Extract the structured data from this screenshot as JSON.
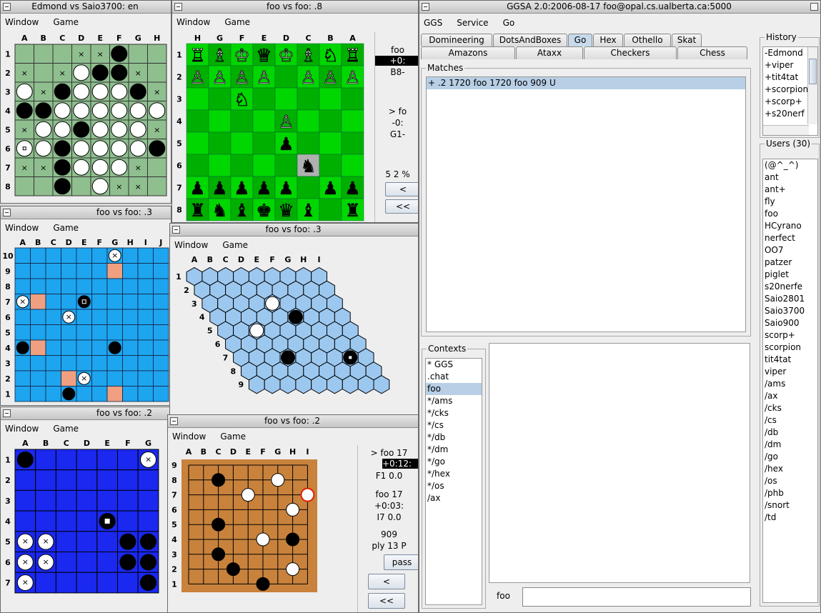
{
  "menus": {
    "window": "Window",
    "game": "Game"
  },
  "othello": {
    "title": "Edmond vs Saio3700: en",
    "cols": [
      "A",
      "B",
      "C",
      "D",
      "E",
      "F",
      "G",
      "H"
    ],
    "rows": [
      "1",
      "2",
      "3",
      "4",
      "5",
      "6",
      "7",
      "8"
    ],
    "board": [
      "...xxB..",
      "x.xWBBx.",
      "WxBWWWBx",
      "BBWWWWWW",
      "xWWBWWWx",
      "oWBWWWWB",
      "xxBWWWx.",
      "..B.Wxx."
    ]
  },
  "chess": {
    "title": "foo vs foo: .8",
    "cols": [
      "H",
      "G",
      "F",
      "E",
      "D",
      "C",
      "B",
      "A"
    ],
    "rows": [
      "1",
      "2",
      "3",
      "4",
      "5",
      "6",
      "7",
      "8"
    ],
    "board": [
      "RBKQKBNR",
      "PPPP.PPP",
      "..N.....",
      "....P...",
      "....p...",
      ".....n..",
      "ppppp.pp",
      "rnbkqb.r"
    ],
    "side": {
      "l1": "foo",
      "l2": "+0:",
      "l3": "B8-",
      "l4": "> fo",
      "l5": "-0:",
      "l6": "G1-",
      "l7": "5 2 %",
      "b1": "<",
      "b2": "<<"
    }
  },
  "amazons": {
    "title": "foo vs foo: .3",
    "cols": [
      "A",
      "B",
      "C",
      "D",
      "E",
      "F",
      "G",
      "H",
      "I",
      "J"
    ],
    "rows": [
      "10",
      "9",
      "8",
      "7",
      "6",
      "5",
      "4",
      "3",
      "2",
      "1"
    ],
    "board": [
      "......w...",
      "......a...",
      "..........",
      "wa..b.....",
      "...w......",
      "..........",
      "Ba....B...",
      "..........",
      "...aw.....",
      "...B..a..."
    ]
  },
  "hex": {
    "title": "foo vs foo: .3",
    "cols": [
      "A",
      "B",
      "C",
      "D",
      "E",
      "F",
      "G",
      "H",
      "I"
    ],
    "rows": [
      "1",
      "2",
      "3",
      "4",
      "5",
      "6",
      "7",
      "8",
      "9"
    ],
    "stones": [
      {
        "r": 3,
        "c": 5,
        "s": "W"
      },
      {
        "r": 4,
        "c": 6,
        "s": "B"
      },
      {
        "r": 5,
        "c": 3,
        "s": "W"
      },
      {
        "r": 7,
        "c": 4,
        "s": "B"
      },
      {
        "r": 7,
        "c": 8,
        "s": "M"
      }
    ]
  },
  "dots": {
    "title": "foo vs foo: .2",
    "cols": [
      "A",
      "B",
      "C",
      "D",
      "E",
      "F",
      "G"
    ],
    "rows": [
      "1",
      "2",
      "3",
      "4",
      "5",
      "6",
      "7"
    ],
    "board": [
      "B.....w",
      ".......",
      ".......",
      "....o..",
      "ww...BB",
      "ww...BB",
      "w.....B"
    ]
  },
  "go": {
    "title": "foo vs foo: .2",
    "cols": [
      "A",
      "B",
      "C",
      "D",
      "E",
      "F",
      "G",
      "H",
      "I"
    ],
    "rows": [
      "9",
      "8",
      "7",
      "6",
      "5",
      "4",
      "3",
      "2",
      "1"
    ],
    "stones": [
      {
        "c": 3,
        "r": 8,
        "s": "B"
      },
      {
        "c": 7,
        "r": 8,
        "s": "W"
      },
      {
        "c": 5,
        "r": 7,
        "s": "W"
      },
      {
        "c": 9,
        "r": 7,
        "s": "L"
      },
      {
        "c": 8,
        "r": 6,
        "s": "W"
      },
      {
        "c": 3,
        "r": 5,
        "s": "B"
      },
      {
        "c": 6,
        "r": 4,
        "s": "W"
      },
      {
        "c": 8,
        "r": 4,
        "s": "B"
      },
      {
        "c": 3,
        "r": 3,
        "s": "B"
      },
      {
        "c": 4,
        "r": 2,
        "s": "B"
      },
      {
        "c": 8,
        "r": 2,
        "s": "W"
      },
      {
        "c": 6,
        "r": 1,
        "s": "B"
      }
    ],
    "side": {
      "l1": "> foo 17",
      "l2": "+0:12:",
      "l3": "F1 0.0",
      "l4": "foo 17",
      "l5": "+0:03:",
      "l6": "I7 0.0",
      "l7": "909",
      "l8": "ply 13 P",
      "pass": "pass",
      "b1": "<",
      "b2": "<<"
    }
  },
  "ggsa": {
    "title": "GGSA 2.0:2006-08-17 foo@opal.cs.ualberta.ca:5000",
    "menu": [
      "GGS",
      "Service",
      "Go"
    ],
    "tabs_top": [
      "Domineering",
      "DotsAndBoxes",
      "Go",
      "Hex",
      "Othello",
      "Skat"
    ],
    "tabs_bottom": [
      "Amazons",
      "Ataxx",
      "Checkers",
      "Chess"
    ],
    "matches_label": "Matches",
    "matches": [
      "+ .2 1720 foo 1720 foo 909 U"
    ],
    "contexts_label": "Contexts",
    "contexts": [
      "* GGS",
      ".chat",
      "foo",
      "*/ams",
      "*/cks",
      "*/cs",
      "*/db",
      "*/dm",
      "*/go",
      "*/hex",
      "*/os",
      "/ax"
    ],
    "context_selected": "foo",
    "prompt": "foo",
    "history_label": "History",
    "history": [
      "-Edmond",
      "+viper",
      "+tit4tat",
      "+scorpion",
      "+scorp+",
      "+s20nerf"
    ],
    "users_label": "Users (30)",
    "users": [
      "(@^_^)",
      "ant",
      "ant+",
      "fly",
      "foo",
      "HCyrano",
      "nerfect",
      "OO7",
      "patzer",
      "piglet",
      "s20nerfe",
      "Saio2801",
      "Saio3700",
      "Saio900",
      "scorp+",
      "scorpion",
      "tit4tat",
      "viper",
      "/ams",
      "/ax",
      "/cks",
      "/cs",
      "/db",
      "/dm",
      "/go",
      "/hex",
      "/os",
      "/phb",
      "/snort",
      "/td"
    ]
  },
  "colors": {
    "othello_board": "#8fbf8f",
    "chess_light": "#00d700",
    "chess_dark": "#00b000",
    "amazons_board": "#1ea5f0",
    "amazons_arrow": "#f0a080",
    "hex_cell": "#9cc8f0",
    "dots_board": "#1a28f0",
    "go_board": "#c8823c",
    "selection": "#b8cfe5"
  }
}
